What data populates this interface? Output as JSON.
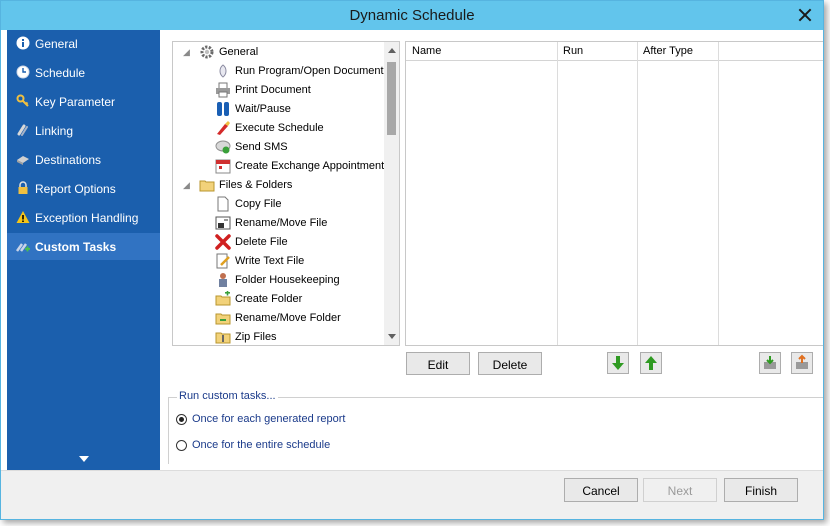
{
  "window": {
    "title": "Dynamic Schedule"
  },
  "sidebar": {
    "items": [
      {
        "label": "General",
        "icon": "info-icon"
      },
      {
        "label": "Schedule",
        "icon": "clock-icon"
      },
      {
        "label": "Key Parameter",
        "icon": "key-icon"
      },
      {
        "label": "Linking",
        "icon": "link-icon"
      },
      {
        "label": "Destinations",
        "icon": "destinations-icon"
      },
      {
        "label": "Report Options",
        "icon": "lock-icon"
      },
      {
        "label": "Exception Handling",
        "icon": "warning-icon"
      },
      {
        "label": "Custom Tasks",
        "icon": "custom-tasks-icon",
        "active": true
      }
    ]
  },
  "tree": {
    "groups": [
      {
        "label": "General",
        "icon": "gear-icon",
        "items": [
          {
            "label": "Run Program/Open Document",
            "icon": "run-program-icon"
          },
          {
            "label": "Print Document",
            "icon": "printer-icon"
          },
          {
            "label": "Wait/Pause",
            "icon": "pause-icon"
          },
          {
            "label": "Execute Schedule",
            "icon": "execute-schedule-icon"
          },
          {
            "label": "Send SMS",
            "icon": "sms-icon"
          },
          {
            "label": "Create Exchange Appointment",
            "icon": "calendar-icon"
          }
        ]
      },
      {
        "label": "Files & Folders",
        "icon": "folder-icon",
        "items": [
          {
            "label": "Copy File",
            "icon": "copy-file-icon"
          },
          {
            "label": "Rename/Move File",
            "icon": "rename-file-icon"
          },
          {
            "label": "Delete File",
            "icon": "delete-x-icon"
          },
          {
            "label": "Write Text File",
            "icon": "write-text-icon"
          },
          {
            "label": "Folder Housekeeping",
            "icon": "housekeeping-icon"
          },
          {
            "label": "Create Folder",
            "icon": "create-folder-icon"
          },
          {
            "label": "Rename/Move Folder",
            "icon": "rename-folder-icon"
          },
          {
            "label": "Zip Files",
            "icon": "zip-icon"
          }
        ]
      }
    ]
  },
  "task_grid": {
    "columns": [
      "Name",
      "Run",
      "After Type"
    ]
  },
  "buttons": {
    "edit": "Edit",
    "delete": "Delete",
    "cancel": "Cancel",
    "next": "Next",
    "finish": "Finish"
  },
  "run_group": {
    "title": "Run custom tasks...",
    "options": [
      {
        "label": "Once for each generated report",
        "checked": true
      },
      {
        "label": "Once for the entire schedule",
        "checked": false
      }
    ]
  },
  "colors": {
    "titlebar": "#62c5ec",
    "sidebar": "#1b5fad",
    "sidebar_active": "#3173c2",
    "accent_green": "#2f9a22"
  }
}
